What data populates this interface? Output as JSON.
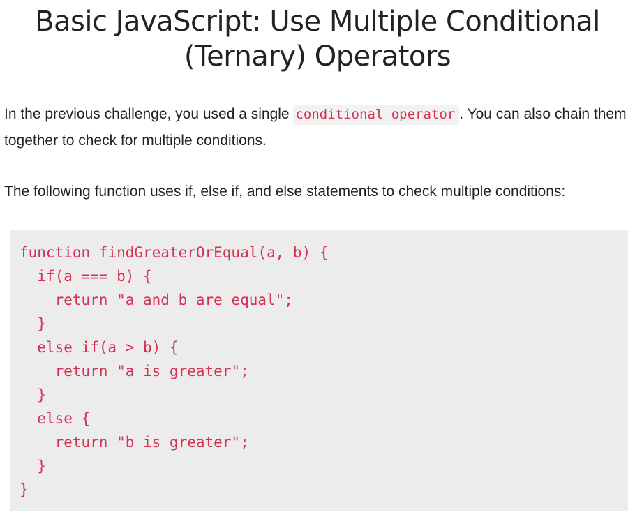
{
  "header": {
    "title_line1": "Basic JavaScript: Use Multiple Conditional",
    "title_line2": "(Ternary) Operators"
  },
  "intro": {
    "text_before": "In the previous challenge, you used a single ",
    "code": "conditional operator",
    "text_after": ". You can also chain them together to check for multiple conditions."
  },
  "description": {
    "text": "The following function uses if, else if, and else statements to check multiple conditions:"
  },
  "code_block": {
    "lines": [
      "function findGreaterOrEqual(a, b) {",
      "  if(a === b) {",
      "    return \"a and b are equal\";",
      "  }",
      "  else if(a > b) {",
      "    return \"a is greater\";",
      "  }",
      "  else {",
      "    return \"b is greater\";",
      "  }",
      "}"
    ]
  }
}
